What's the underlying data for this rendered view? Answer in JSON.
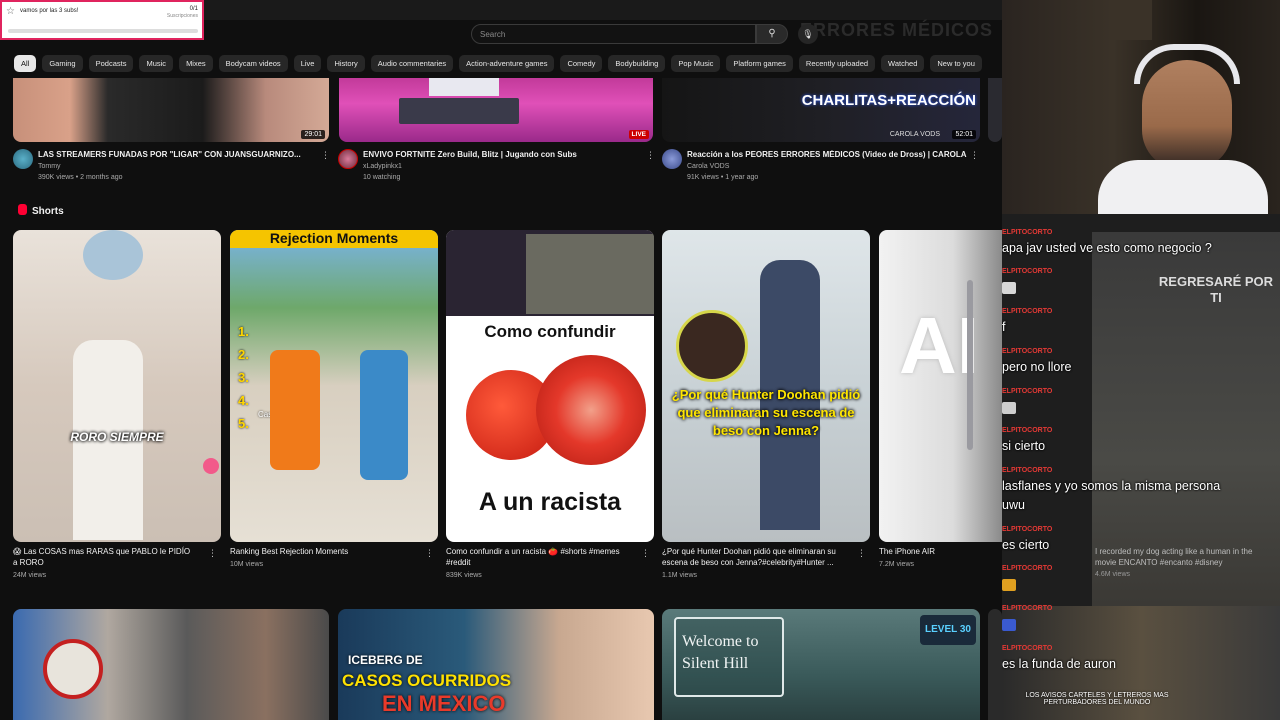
{
  "subs_widget": {
    "label": "vamos por las 3 subs!",
    "count": "0/1",
    "sub_label": "Suscripciones"
  },
  "search": {
    "placeholder": "Search"
  },
  "chips": [
    "All",
    "Gaming",
    "Podcasts",
    "Music",
    "Mixes",
    "Bodycam videos",
    "Live",
    "History",
    "Audio commentaries",
    "Action-adventure games",
    "Comedy",
    "Bodybuilding",
    "Pop Music",
    "Platform games",
    "Recently uploaded",
    "Watched",
    "New to you"
  ],
  "top_videos": [
    {
      "title": "LAS STREAMERS FUNADAS POR \"LIGAR\" CON JUANSGUARNIZO...",
      "channel": "Tommy",
      "stats": "390K views • 2 months ago",
      "duration": "29:01"
    },
    {
      "title": "ENVIVO FORTNITE  Zero Build,   Blitz   |  Jugando con Subs",
      "channel": "xLadypinkx1",
      "stats": "10 watching",
      "badge": "LIVE"
    },
    {
      "title": "Reacción a los PEORES ERRORES MÉDICOS (Video de Dross) | CAROLA",
      "channel": "Carola VODS",
      "stats": "91K views • 1 year ago",
      "duration": "52:01",
      "thumb_text": "CHARLITAS+REACCIÓN",
      "thumb_sub": "CAROLA VODS"
    }
  ],
  "ghost_title": "ERRORES MÉDICOS",
  "shorts": {
    "heading": "Shorts",
    "items": [
      {
        "title": "😱 Las COSAS mas RARAS que PABLO le PIDÍO a RORO",
        "views": "24M views",
        "overlay": "RORO SIEMPRE"
      },
      {
        "title": "Ranking Best Rejection Moments",
        "views": "10M views",
        "overlay": "Rejection Moments",
        "list": [
          "1.",
          "2.",
          "3.",
          "4.",
          "5."
        ],
        "list_extra": "Cash wins"
      },
      {
        "title": "Como confundir a un racista 🍅 #shorts #memes #reddit",
        "views": "839K views",
        "overlay_top": "Como confundir",
        "overlay_bottom": "A un racista"
      },
      {
        "title": "¿Por qué Hunter Doohan pidió que eliminaran su escena de beso con Jenna?#celebrity#Hunter ...",
        "views": "1.1M views",
        "overlay": "¿Por qué Hunter Doohan pidió que eliminaran su escena de beso con Jenna?"
      },
      {
        "title": "The iPhone AIR",
        "views": "7.2M views"
      },
      {
        "title": "I recorded my dog acting like a human in the movie ENCANTO #encanto #disney",
        "views": "4.6M views",
        "overlay": "REGRESARÉ POR TI"
      }
    ]
  },
  "bottom_thumbs": [
    {
      "text": ""
    },
    {
      "text_top": "ICEBERG DE",
      "text_mid": "CASOS OCURRIDOS",
      "text_bot": "EN MEXICO"
    },
    {
      "text": "Welcome to Silent Hill",
      "badge": "LEVEL 30"
    },
    {
      "text": "LOS AVISOS CARTELES Y LETREROS MAS PERTURBADORES DEL MUNDO"
    }
  ],
  "chat": [
    {
      "user": "ELPITOCORTO",
      "text": "apa jav usted ve esto como negocio ?"
    },
    {
      "user": "ELPITOCORTO",
      "emote": true
    },
    {
      "user": "ELPITOCORTO",
      "text": "f"
    },
    {
      "user": "ELPITOCORTO",
      "text": "pero no llore"
    },
    {
      "user": "ELPITOCORTO",
      "emote": true
    },
    {
      "user": "ELPITOCORTO",
      "text": "si cierto"
    },
    {
      "user": "ELPITOCORTO",
      "text": "lasflanes y yo somos la misma persona",
      "text2": "uwu"
    },
    {
      "user": "ELPITOCORTO",
      "text": "es cierto"
    },
    {
      "user": "ELPITOCORTO",
      "emote": true
    },
    {
      "user": "ELPITOCORTO",
      "emote": true
    },
    {
      "user": "ELPITOCORTO",
      "text": "es la funda de auron"
    }
  ],
  "colors": {
    "accent": "#ff0033",
    "chat_user": "#e53935",
    "background": "#0f0f0f"
  }
}
